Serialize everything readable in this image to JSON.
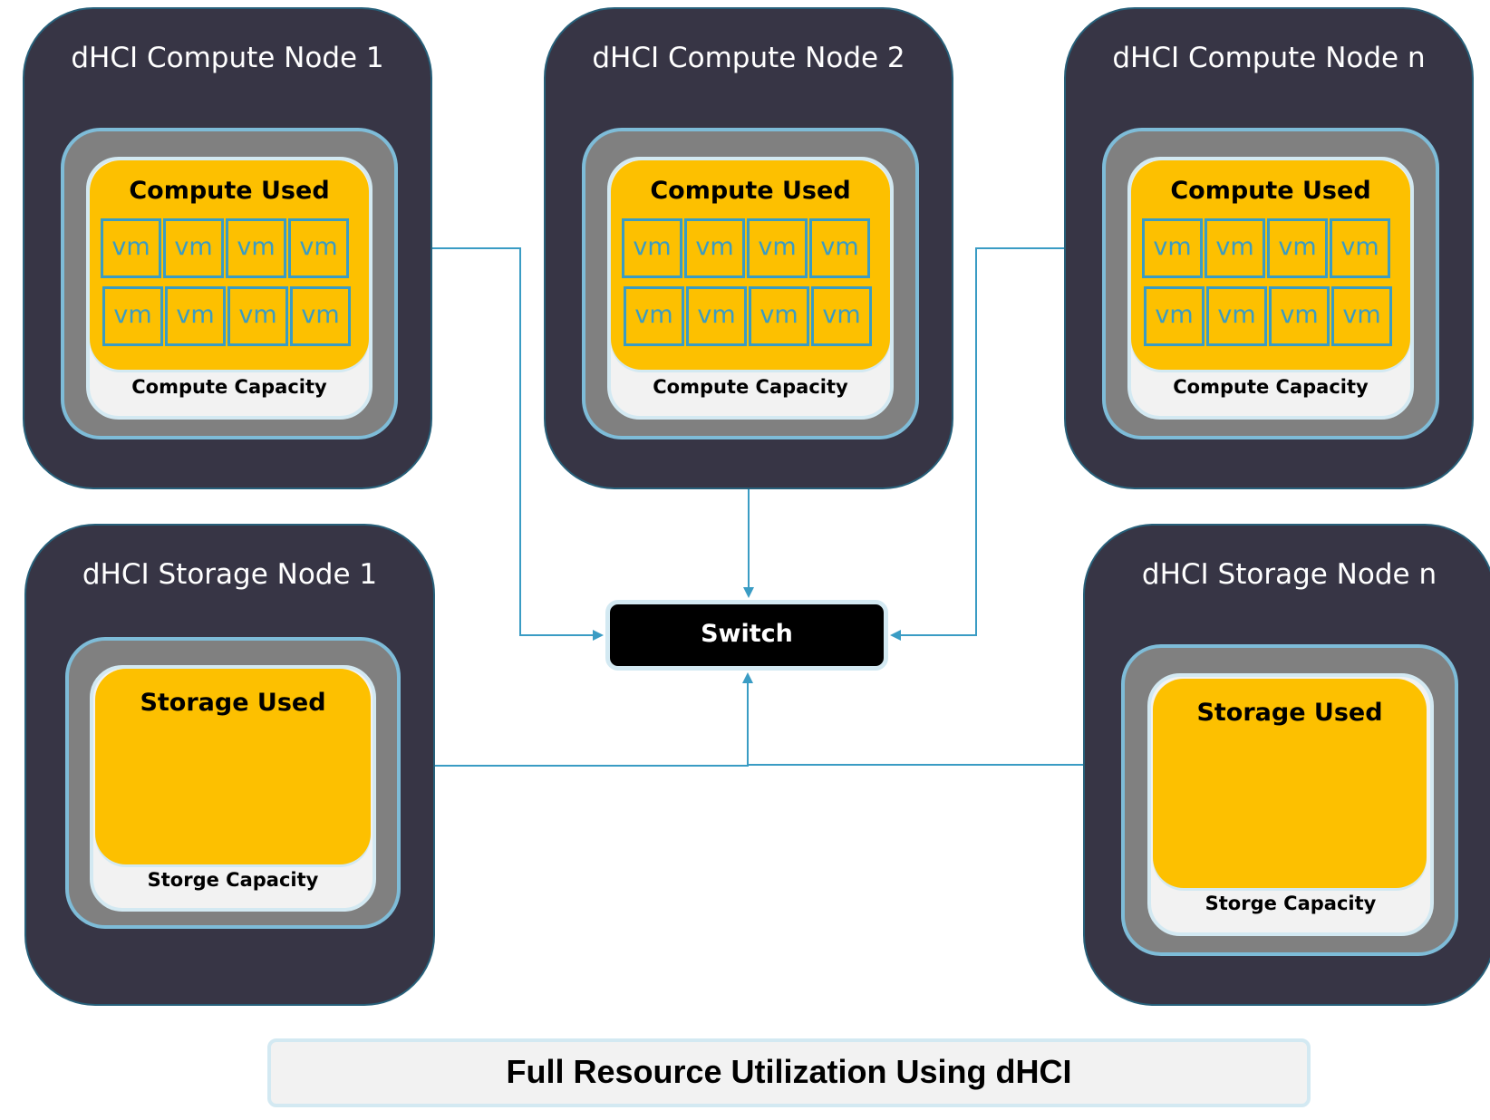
{
  "diagram": {
    "title": "Full Resource Utilization Using dHCI",
    "switch_label": "Switch",
    "colors": {
      "node_bg": "#373545",
      "capacity_gray": "#808080",
      "capacity_border": "#7ebcd8",
      "used_yellow": "#fdc000",
      "vm_blue": "#3a9cc4",
      "connector": "#3a9cc4",
      "switch_bg": "#000000"
    },
    "compute_nodes": [
      {
        "title": "dHCI Compute Node 1",
        "used_label": "Compute Used",
        "capacity_label": "Compute Capacity",
        "vms": [
          "vm",
          "vm",
          "vm",
          "vm",
          "vm",
          "vm",
          "vm",
          "vm"
        ]
      },
      {
        "title": "dHCI Compute Node 2",
        "used_label": "Compute Used",
        "capacity_label": "Compute Capacity",
        "vms": [
          "vm",
          "vm",
          "vm",
          "vm",
          "vm",
          "vm",
          "vm",
          "vm"
        ]
      },
      {
        "title": "dHCI Compute Node n",
        "used_label": "Compute Used",
        "capacity_label": "Compute Capacity",
        "vms": [
          "vm",
          "vm",
          "vm",
          "vm",
          "vm",
          "vm",
          "vm",
          "vm"
        ]
      }
    ],
    "storage_nodes": [
      {
        "title": "dHCI Storage Node 1",
        "used_label": "Storage Used",
        "capacity_label": "Storge Capacity"
      },
      {
        "title": "dHCI Storage Node n",
        "used_label": "Storage Used",
        "capacity_label": "Storge Capacity"
      }
    ],
    "connections": [
      {
        "from": "dHCI Compute Node 1",
        "to": "Switch"
      },
      {
        "from": "dHCI Compute Node 2",
        "to": "Switch"
      },
      {
        "from": "dHCI Compute Node n",
        "to": "Switch"
      },
      {
        "from": "dHCI Storage Node 1",
        "to": "Switch"
      },
      {
        "from": "dHCI Storage Node n",
        "to": "Switch"
      }
    ]
  }
}
